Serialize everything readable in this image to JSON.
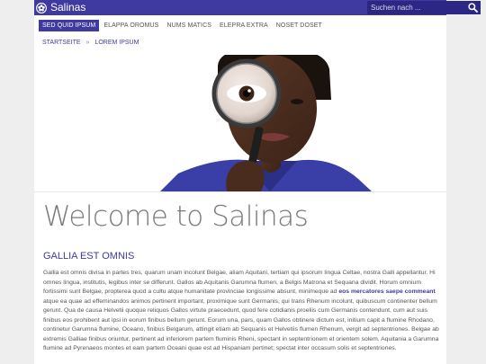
{
  "header": {
    "brand": "Salinas",
    "search_placeholder": "Suchen nach ...",
    "colors": {
      "accent": "#3f3aa0",
      "search_bg": "#2c2785",
      "page_bg": "#eeeeee"
    }
  },
  "nav": {
    "items": [
      {
        "label": "SED QUID IPSUM",
        "active": true
      },
      {
        "label": "ELAPPA OROMUS",
        "active": false
      },
      {
        "label": "NUMS MATICS",
        "active": false
      },
      {
        "label": "ELEPRA EXTRA",
        "active": false
      },
      {
        "label": "NOSET DOSET",
        "active": false
      }
    ]
  },
  "breadcrumb": {
    "items": [
      "STARTSEITE",
      "LOREM IPSUM"
    ],
    "separator": "»"
  },
  "hero": {
    "icon": "woman-with-magnifying-glass-image"
  },
  "main": {
    "title": "Welcome to Salinas",
    "subtitle": "GALLIA EST OMNIS",
    "paragraph_before_bold": "Gallia est omnis divisa in partes tres, quarum unam incolunt Belgae, aliam Aquitani, tertiam qui ipsorum lingua Celtae, nostra Galli appellantur. Hi omnes lingua, institutis, legibus inter se differunt. Gallos ab Aquitanis Garumna flumen, a Belgis Matrona et Sequana dividit. Horum omnium fortissimi sunt Belgae, propterea quod a cultu atque humanitate provinciae longissime absunt, minimeque ad",
    "paragraph_bold": "eos mercatores saepe commeant",
    "paragraph_after_bold": "atque ea quae ad effeminandos animos pertinent important, proximique sunt Germanis, qui trans Rhenum incolunt, quibuscum continenter bellum gerunt. Qua de causa Helvetii quoque reliquos Gallos virtute praecedunt, quod fere cotidianis proeliis cum Germanis contendunt, cum aut suis finibus eos prohibent aut ipsi in eorum finibus bellum gerunt. Eorum una, pars, quam Gallos obtinere dictum est, initium capit a flumine Rhodano, continetur Garumna flumine, Oceano, finibus Belgarum, attingit etiam ab Sequanis et Helvetiis flumen Rhenum, vergit ad septentriones. Belgae ab extremis Galliae finibus oriuntur, pertinent ad inferiorem partem fluminis Rheni, spectant in septentrionem et orientem solem. Aquitania a Garumna flumine ad Pyrenaeos montes et eam partem Oceani quae est ad Hispaniam pertinet; spectat inter occasum solis et septentriones."
  }
}
